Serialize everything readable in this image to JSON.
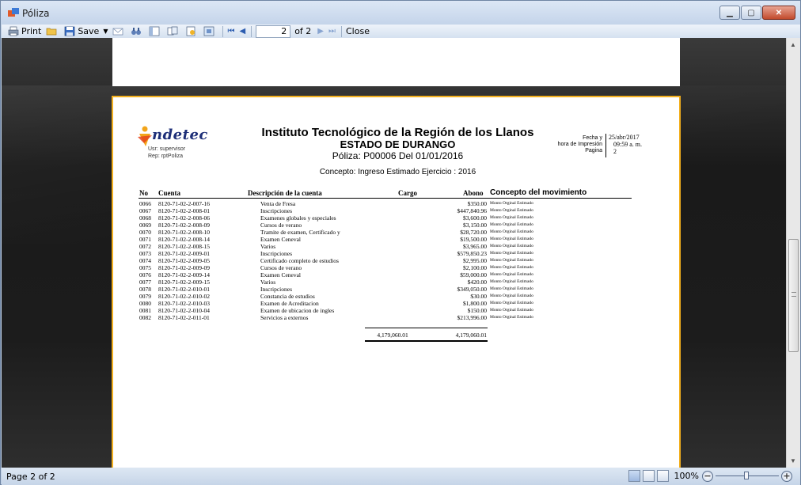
{
  "window": {
    "title": "Póliza"
  },
  "toolbar": {
    "print_label": "Print",
    "save_label": "Save",
    "page_input": "2",
    "page_of": "of 2",
    "close_label": "Close"
  },
  "status": {
    "page_text": "Page 2 of 2",
    "zoom": "100%"
  },
  "report": {
    "logo": "ndetec",
    "user_line": "Usr: supervisor",
    "report_line": "Rep: rptPoliza",
    "institution": "Instituto Tecnológico de la Región de los Llanos",
    "state": "ESTADO DE DURANGO",
    "poliza_line": "Póliza:  P00006  Del 01/01/2016",
    "concepto_line": "Concepto: Ingreso Estimado Ejercicio : 2016",
    "fecha_label_1": "Fecha y",
    "fecha_label_2": "hora de Impresión",
    "fecha_label_3": "Pagina",
    "fecha_value": "25/abr/2017",
    "hora_value": "09:59 a. m.",
    "pagina_value": "2",
    "headers": {
      "no": "No",
      "cuenta": "Cuenta",
      "descripcion": "Descripción de la cuenta",
      "cargo": "Cargo",
      "abono": "Abono",
      "concepto": "Concepto del movimiento"
    },
    "rows": [
      {
        "no": "0066",
        "cuenta": "8120-71-02-2-007-16",
        "desc": "Venta de Fresa",
        "abono": "$350.00",
        "concepto": "Monto Orginal Estimado"
      },
      {
        "no": "0067",
        "cuenta": "8120-71-02-2-008-01",
        "desc": "Inscripciones",
        "abono": "$447,840.96",
        "concepto": "Monto Orginal Estimado"
      },
      {
        "no": "0068",
        "cuenta": "8120-71-02-2-008-06",
        "desc": "Examenes globales y especiales",
        "abono": "$3,600.00",
        "concepto": "Monto Orginal Estimado"
      },
      {
        "no": "0069",
        "cuenta": "8120-71-02-2-008-09",
        "desc": "Cursos de verano",
        "abono": "$3,150.00",
        "concepto": "Monto Orginal Estimado"
      },
      {
        "no": "0070",
        "cuenta": "8120-71-02-2-008-10",
        "desc": "Tramite de examen, Certificado y",
        "abono": "$28,720.00",
        "concepto": "Monto Orginal Estimado"
      },
      {
        "no": "0071",
        "cuenta": "8120-71-02-2-008-14",
        "desc": "Examen Ceneval",
        "abono": "$19,500.00",
        "concepto": "Monto Orginal Estimado"
      },
      {
        "no": "0072",
        "cuenta": "8120-71-02-2-008-15",
        "desc": "Varios",
        "abono": "$3,965.00",
        "concepto": "Monto Orginal Estimado"
      },
      {
        "no": "0073",
        "cuenta": "8120-71-02-2-009-01",
        "desc": "Inscripciones",
        "abono": "$579,850.23",
        "concepto": "Monto Orginal Estimado"
      },
      {
        "no": "0074",
        "cuenta": "8120-71-02-2-009-05",
        "desc": "Certificado completo de estudios",
        "abono": "$2,995.00",
        "concepto": "Monto Orginal Estimado"
      },
      {
        "no": "0075",
        "cuenta": "8120-71-02-2-009-09",
        "desc": "Cursos de verano",
        "abono": "$2,100.00",
        "concepto": "Monto Orginal Estimado"
      },
      {
        "no": "0076",
        "cuenta": "8120-71-02-2-009-14",
        "desc": "Examen Ceneval",
        "abono": "$59,000.00",
        "concepto": "Monto Orginal Estimado"
      },
      {
        "no": "0077",
        "cuenta": "8120-71-02-2-009-15",
        "desc": "Varios",
        "abono": "$420.00",
        "concepto": "Monto Orginal Estimado"
      },
      {
        "no": "0078",
        "cuenta": "8120-71-02-2-010-01",
        "desc": "Inscripciones",
        "abono": "$349,050.00",
        "concepto": "Monto Orginal Estimado"
      },
      {
        "no": "0079",
        "cuenta": "8120-71-02-2-010-02",
        "desc": "Constancia de estudios",
        "abono": "$30.00",
        "concepto": "Monto Orginal Estimado"
      },
      {
        "no": "0080",
        "cuenta": "8120-71-02-2-010-03",
        "desc": "Examen de Acreditacion",
        "abono": "$1,800.00",
        "concepto": "Monto Orginal Estimado"
      },
      {
        "no": "0081",
        "cuenta": "8120-71-02-2-010-04",
        "desc": "Examen de ubicacion de ingles",
        "abono": "$150.00",
        "concepto": "Monto Orginal Estimado"
      },
      {
        "no": "0082",
        "cuenta": "8120-71-02-2-011-01",
        "desc": "Servicios a externos",
        "abono": "$213,996.00",
        "concepto": "Monto Orginal Estimado"
      }
    ],
    "total_cargo": "4,179,060.01",
    "total_abono": "4,179,060.01"
  }
}
